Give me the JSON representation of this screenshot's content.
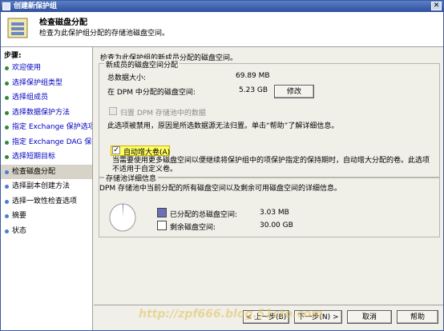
{
  "window": {
    "title": "创建新保护组"
  },
  "header": {
    "title": "检查磁盘分配",
    "subtitle": "检查为此保护组分配的存储池磁盘空间。"
  },
  "steps": {
    "heading": "步骤:",
    "items": [
      {
        "label": "欢迎使用",
        "state": "done"
      },
      {
        "label": "选择保护组类型",
        "state": "done"
      },
      {
        "label": "选择组成员",
        "state": "done"
      },
      {
        "label": "选择数据保护方法",
        "state": "done"
      },
      {
        "label": "指定 Exchange 保护选项",
        "state": "done"
      },
      {
        "label": "指定 Exchange DAG 保护",
        "state": "done"
      },
      {
        "label": "选择短期目标",
        "state": "done"
      },
      {
        "label": "检查磁盘分配",
        "state": "current"
      },
      {
        "label": "选择副本创建方法",
        "state": "pending"
      },
      {
        "label": "选择一致性检查选项",
        "state": "pending"
      },
      {
        "label": "摘要",
        "state": "pending"
      },
      {
        "label": "状态",
        "state": "pending"
      }
    ]
  },
  "main": {
    "description": "检查为此保护组的新成员分配的磁盘空间。",
    "new_members": {
      "legend": "新成员的磁盘空间分配",
      "total_label": "总数据大小:",
      "total_value": "69.89 MB",
      "dpm_label": "在 DPM 中分配的磁盘空间:",
      "dpm_value": "5.23 GB",
      "modify_button": "修改",
      "colocate_label": "归置 DPM 存储池中的数据",
      "disabled_note": "此选项被禁用，原因是所选数据源无法归置。单击“帮助”了解详细信息。",
      "autogrow_label": "自动增大卷(A)",
      "autogrow_desc": "当需要使用更多磁盘空间以便继续将保护组中的项保护指定的保持期时，自动增大分配的卷。此选项不适用于自定义卷。"
    },
    "storage_pool": {
      "legend": "存储池详细信息",
      "description": "DPM 存储池中当前分配的所有磁盘空间以及剩余可用磁盘空间的详细信息。",
      "allocated_label": "已分配的总磁盘空间:",
      "allocated_value": "3.03 MB",
      "free_label": "剩余磁盘空间:",
      "free_value": "30.00 GB",
      "allocated_color": "#6b6fb8",
      "free_color": "#ffffff",
      "allocated_fraction": 0.0001
    }
  },
  "footer": {
    "back_button": "< 上一步(B)",
    "next_button": "下一步(N) >",
    "cancel_button": "取消",
    "help_button": "帮助"
  },
  "watermark": "http://zpf666.blog.51cto.com"
}
